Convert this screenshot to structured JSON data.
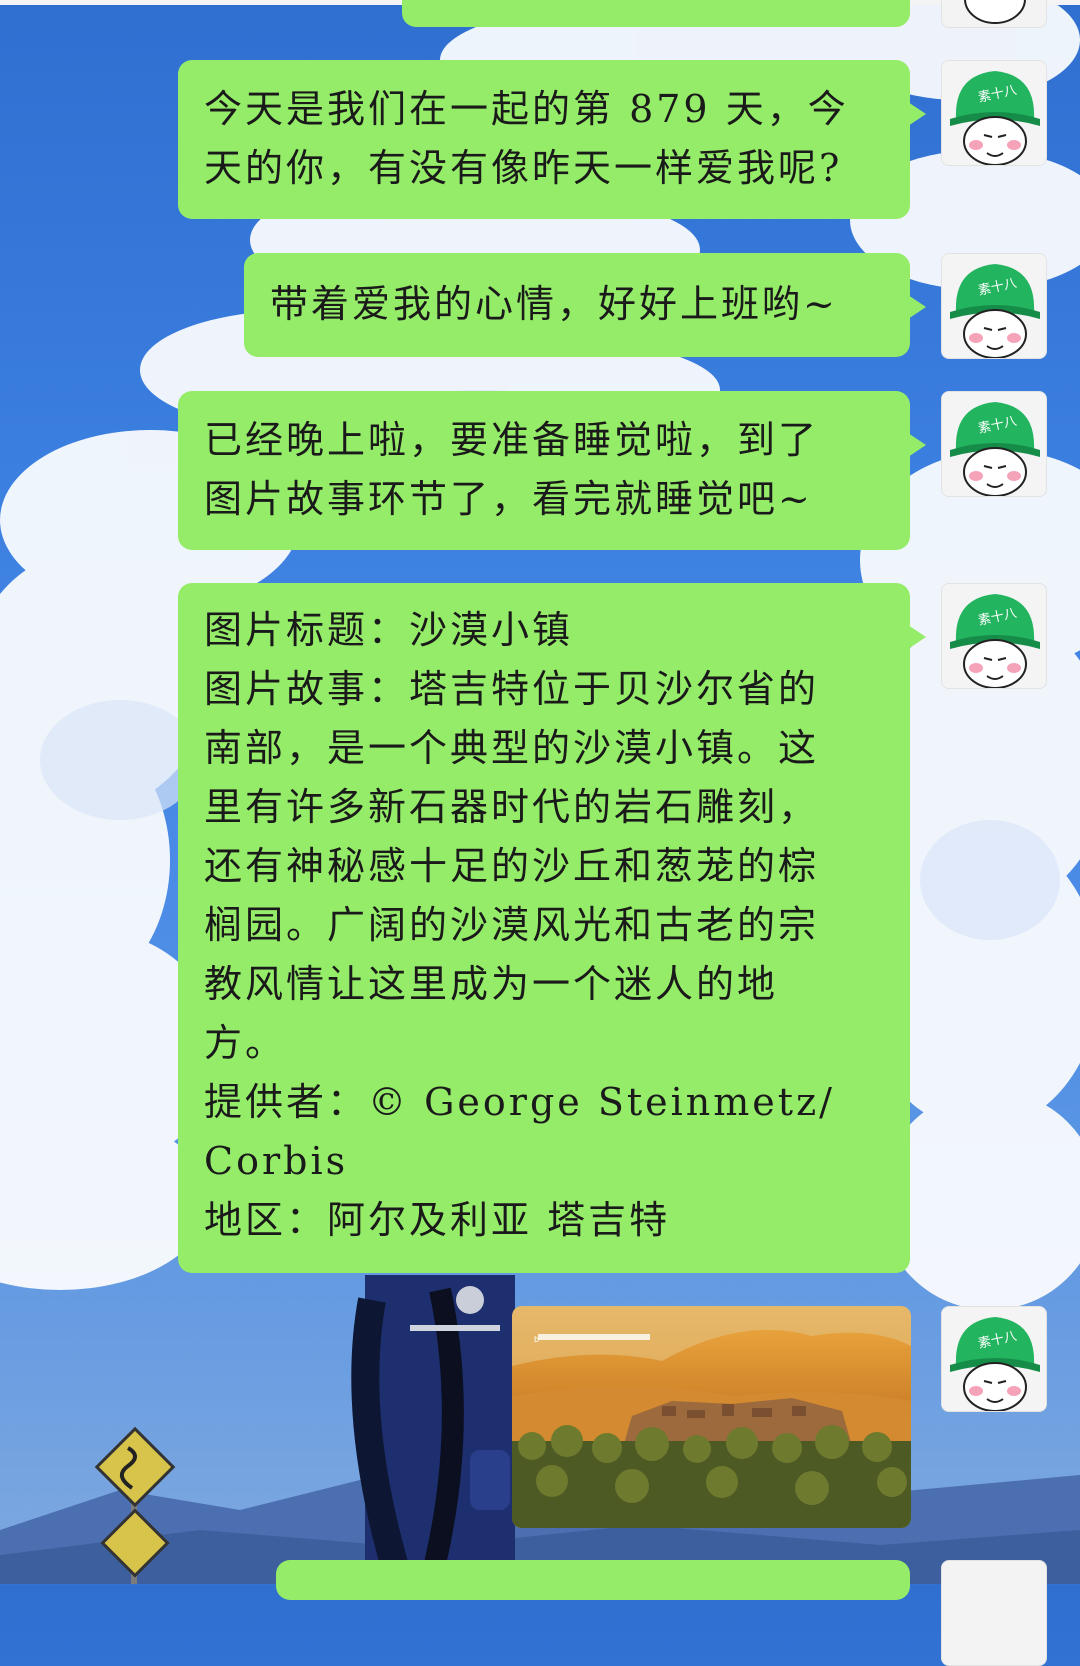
{
  "chat": {
    "avatar_icon": "green-helmet-meme-avatar",
    "avatar_label": "素十八",
    "bubble_color": "#95ec69",
    "messages": [
      {
        "type": "text",
        "lines": [
          "今天是我们在一起的第 879 天，今",
          "天的你，有没有像昨天一样爱我呢?"
        ]
      },
      {
        "type": "text",
        "lines": [
          "带着爱我的心情，好好上班哟~"
        ]
      },
      {
        "type": "text",
        "lines": [
          "已经晚上啦，要准备睡觉啦，到了",
          "图片故事环节了，看完就睡觉吧~"
        ]
      },
      {
        "type": "text",
        "lines": [
          "图片标题：沙漠小镇",
          "图片故事：塔吉特位于贝沙尔省的",
          "南部，是一个典型的沙漠小镇。这",
          "里有许多新石器时代的岩石雕刻，",
          "还有神秘感十足的沙丘和葱茏的棕",
          "榈园。广阔的沙漠风光和古老的宗",
          "教风情让这里成为一个迷人的地",
          "方。",
          "提供者：© George Steinmetz/",
          "Corbis",
          "地区：阿尔及利亚 塔吉特"
        ]
      },
      {
        "type": "image",
        "icon": "desert-town-photo"
      }
    ]
  }
}
